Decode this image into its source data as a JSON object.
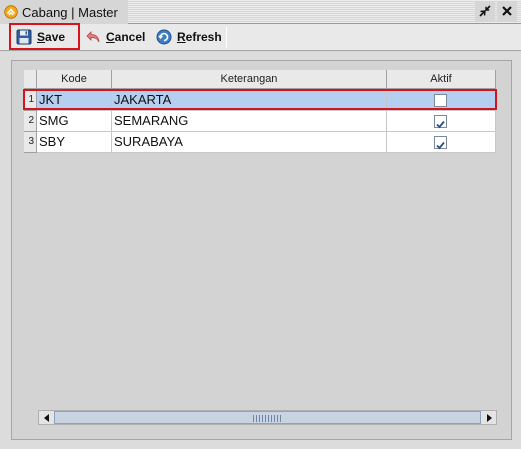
{
  "window": {
    "title": "Cabang | Master",
    "icons": {
      "app": "app-logo-icon",
      "restore": "restore-window-icon",
      "close": "close-icon"
    }
  },
  "toolbar": {
    "save_label": "Save",
    "cancel_label": "Cancel",
    "refresh_label": "Refresh",
    "icons": {
      "save": "floppy-disk-icon",
      "cancel": "undo-arrow-icon",
      "refresh": "refresh-icon"
    }
  },
  "table": {
    "columns": [
      "Kode",
      "Keterangan",
      "Aktif"
    ],
    "rows": [
      {
        "num": "1",
        "kode": "JKT",
        "keterangan": "JAKARTA",
        "aktif": false
      },
      {
        "num": "2",
        "kode": "SMG",
        "keterangan": "SEMARANG",
        "aktif": true
      },
      {
        "num": "3",
        "kode": "SBY",
        "keterangan": "SURABAYA",
        "aktif": true
      }
    ],
    "selected_row": 0
  },
  "colors": {
    "highlight": "#d7141e",
    "selected_row_bg": "#b5cff0",
    "titlebar_bg": "#d6d6d6",
    "panel_bg": "#dcdcdc"
  }
}
